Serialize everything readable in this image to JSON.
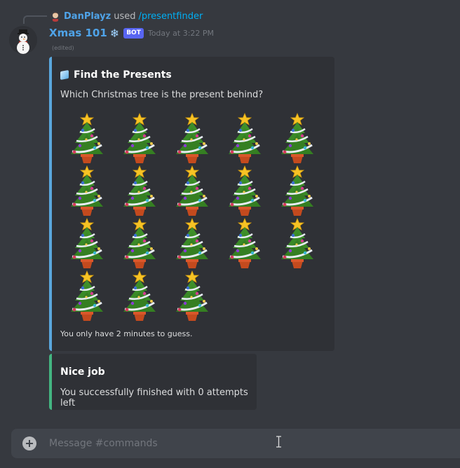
{
  "reply": {
    "username": "DanPlayz",
    "used_text": "used",
    "command": "/presentfinder",
    "avatar_icon": "user-avatar"
  },
  "message": {
    "author": "Xmas 101",
    "author_emoji": "❄",
    "bot_tag": "BOT",
    "timestamp": "Today at 3:22 PM",
    "edited_label": "(edited)",
    "avatar_icon": "snowman-avatar"
  },
  "embeds": [
    {
      "color": "#5aa7dd",
      "title_icon": "ice-cube-icon",
      "title": "Find the Presents",
      "description": "Which Christmas tree is the present behind?",
      "tree_icon": "christmas-tree-icon",
      "tree_count": 18,
      "footer": "You only have 2 minutes to guess."
    },
    {
      "color": "#43b581",
      "title": "Nice job",
      "description": "You successfully finished with 0 attempts left"
    }
  ],
  "composer": {
    "placeholder": "Message #commands",
    "value": "",
    "attach_icon": "plus-circle-icon"
  }
}
